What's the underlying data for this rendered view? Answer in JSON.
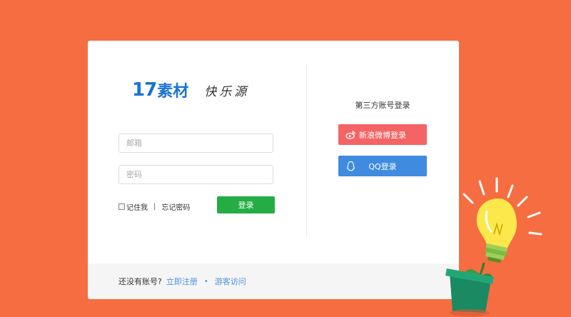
{
  "logo": {
    "number": "17",
    "brand": "素材",
    "slogan": "快乐源"
  },
  "form": {
    "email_placeholder": "邮箱",
    "password_placeholder": "密码",
    "remember_label": "记住我",
    "separator": "|",
    "forgot_label": "忘记密码",
    "login_label": "登录"
  },
  "social": {
    "title": "第三方账号登录",
    "weibo_label": "新浪微博登录",
    "qq_label": "QQ登录",
    "weibo_icon": "weibo-icon",
    "qq_icon": "qq-penguin-icon"
  },
  "footer": {
    "no_account": "还没有账号?",
    "register": "立即注册",
    "dot": "•",
    "guest": "游客访问"
  },
  "colors": {
    "background": "#f56d41",
    "login_button": "#23ad44",
    "weibo": "#f46464",
    "qq": "#3f8be0",
    "link": "#4a90e2",
    "brand": "#1a74d0"
  },
  "decoration": {
    "illustration": "lightbulb-plant-icon"
  }
}
